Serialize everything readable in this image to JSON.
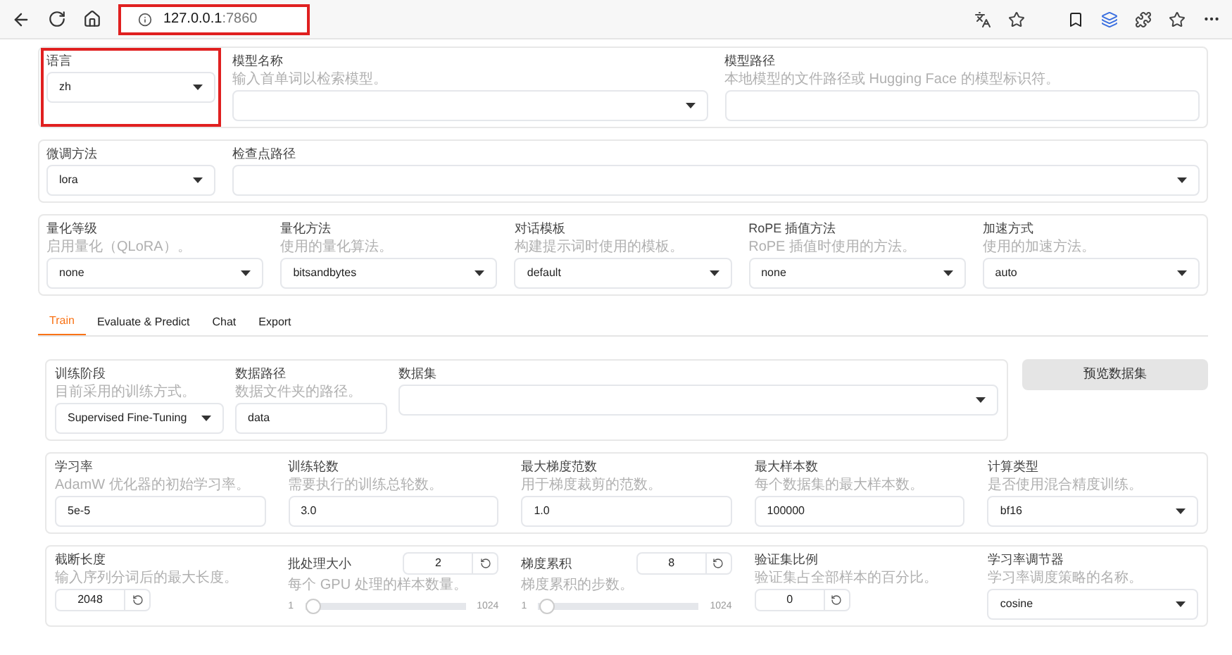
{
  "browser": {
    "address_host": "127.0.0.1",
    "address_port": ":7860",
    "address_highlighted": true
  },
  "sections": [
    {
      "fields": [
        {
          "label": "语言",
          "kind": "dropdown",
          "value": "zh",
          "highlighted": true
        },
        {
          "label": "模型名称",
          "hint": "输入首单词以检索模型。",
          "kind": "dropdown",
          "highlighted": false
        },
        {
          "label": "模型路径",
          "hint": "本地模型的文件路径或 Hugging Face 的模型标识符。",
          "kind": "text",
          "highlighted": false
        }
      ]
    },
    {
      "fields": [
        {
          "label": "微调方法",
          "kind": "dropdown",
          "value": "lora",
          "highlighted": false
        },
        {
          "label": "检查点路径",
          "kind": "dropdown",
          "highlighted": false
        }
      ]
    },
    {
      "fields": [
        {
          "label": "量化等级",
          "hint": "启用量化（QLoRA）。",
          "kind": "dropdown",
          "value": "none",
          "highlighted": false
        },
        {
          "label": "量化方法",
          "hint": "使用的量化算法。",
          "kind": "dropdown",
          "value": "bitsandbytes",
          "highlighted": false
        },
        {
          "label": "对话模板",
          "hint": "构建提示词时使用的模板。",
          "kind": "dropdown",
          "value": "default",
          "highlighted": false
        },
        {
          "label": "RoPE 插值方法",
          "hint": "RoPE 插值时使用的方法。",
          "kind": "dropdown",
          "value": "none",
          "highlighted": false
        },
        {
          "label": "加速方式",
          "hint": "使用的加速方法。",
          "kind": "dropdown",
          "value": "auto",
          "highlighted": false
        }
      ]
    }
  ],
  "tabs": [
    {
      "label": "Train",
      "selected": true
    },
    {
      "label": "Evaluate & Predict",
      "selected": false
    },
    {
      "label": "Chat",
      "selected": false
    },
    {
      "label": "Export",
      "selected": false
    }
  ],
  "train": {
    "fields": [
      {
        "label": "训练阶段",
        "hint": "目前采用的训练方式。",
        "kind": "dropdown",
        "value": "Supervised Fine-Tuning",
        "highlighted": false
      },
      {
        "label": "数据路径",
        "hint": "数据文件夹的路径。",
        "kind": "text",
        "value": "data",
        "highlighted": false
      },
      {
        "label": "数据集",
        "kind": "dropdown",
        "highlighted": false
      }
    ],
    "button": "预览数据集"
  },
  "params": [
    {
      "fields": [
        {
          "label": "学习率",
          "hint": "AdamW 优化器的初始学习率。",
          "kind": "text",
          "value": "5e-5",
          "highlighted": false
        },
        {
          "label": "训练轮数",
          "hint": "需要执行的训练总轮数。",
          "kind": "text",
          "value": "3.0",
          "highlighted": false
        },
        {
          "label": "最大梯度范数",
          "hint": "用于梯度裁剪的范数。",
          "kind": "text",
          "value": "1.0",
          "highlighted": false
        },
        {
          "label": "最大样本数",
          "hint": "每个数据集的最大样本数。",
          "kind": "text",
          "value": "100000",
          "highlighted": false
        },
        {
          "label": "计算类型",
          "hint": "是否使用混合精度训练。",
          "kind": "dropdown",
          "value": "bf16",
          "highlighted": false
        }
      ]
    },
    {
      "fields": [
        {
          "label": "截断长度",
          "hint": "输入序列分词后的最大长度。",
          "kind": "number",
          "value": "2048",
          "highlighted": false
        },
        {
          "label": "批处理大小",
          "hint": "每个 GPU 处理的样本数量。",
          "kind": "slider",
          "value": "2",
          "min": "1",
          "max": "1024",
          "level": 0.001,
          "highlighted": false
        },
        {
          "label": "梯度累积",
          "hint": "梯度累积的步数。",
          "kind": "slider",
          "value": "8",
          "min": "1",
          "max": "1024",
          "level": 0.007,
          "highlighted": false
        },
        {
          "label": "验证集比例",
          "hint": "验证集占全部样本的百分比。",
          "kind": "number",
          "value": "0",
          "highlighted": false
        },
        {
          "label": "学习率调节器",
          "hint": "学习率调度策略的名称。",
          "kind": "dropdown",
          "value": "cosine",
          "highlighted": false
        }
      ]
    }
  ]
}
